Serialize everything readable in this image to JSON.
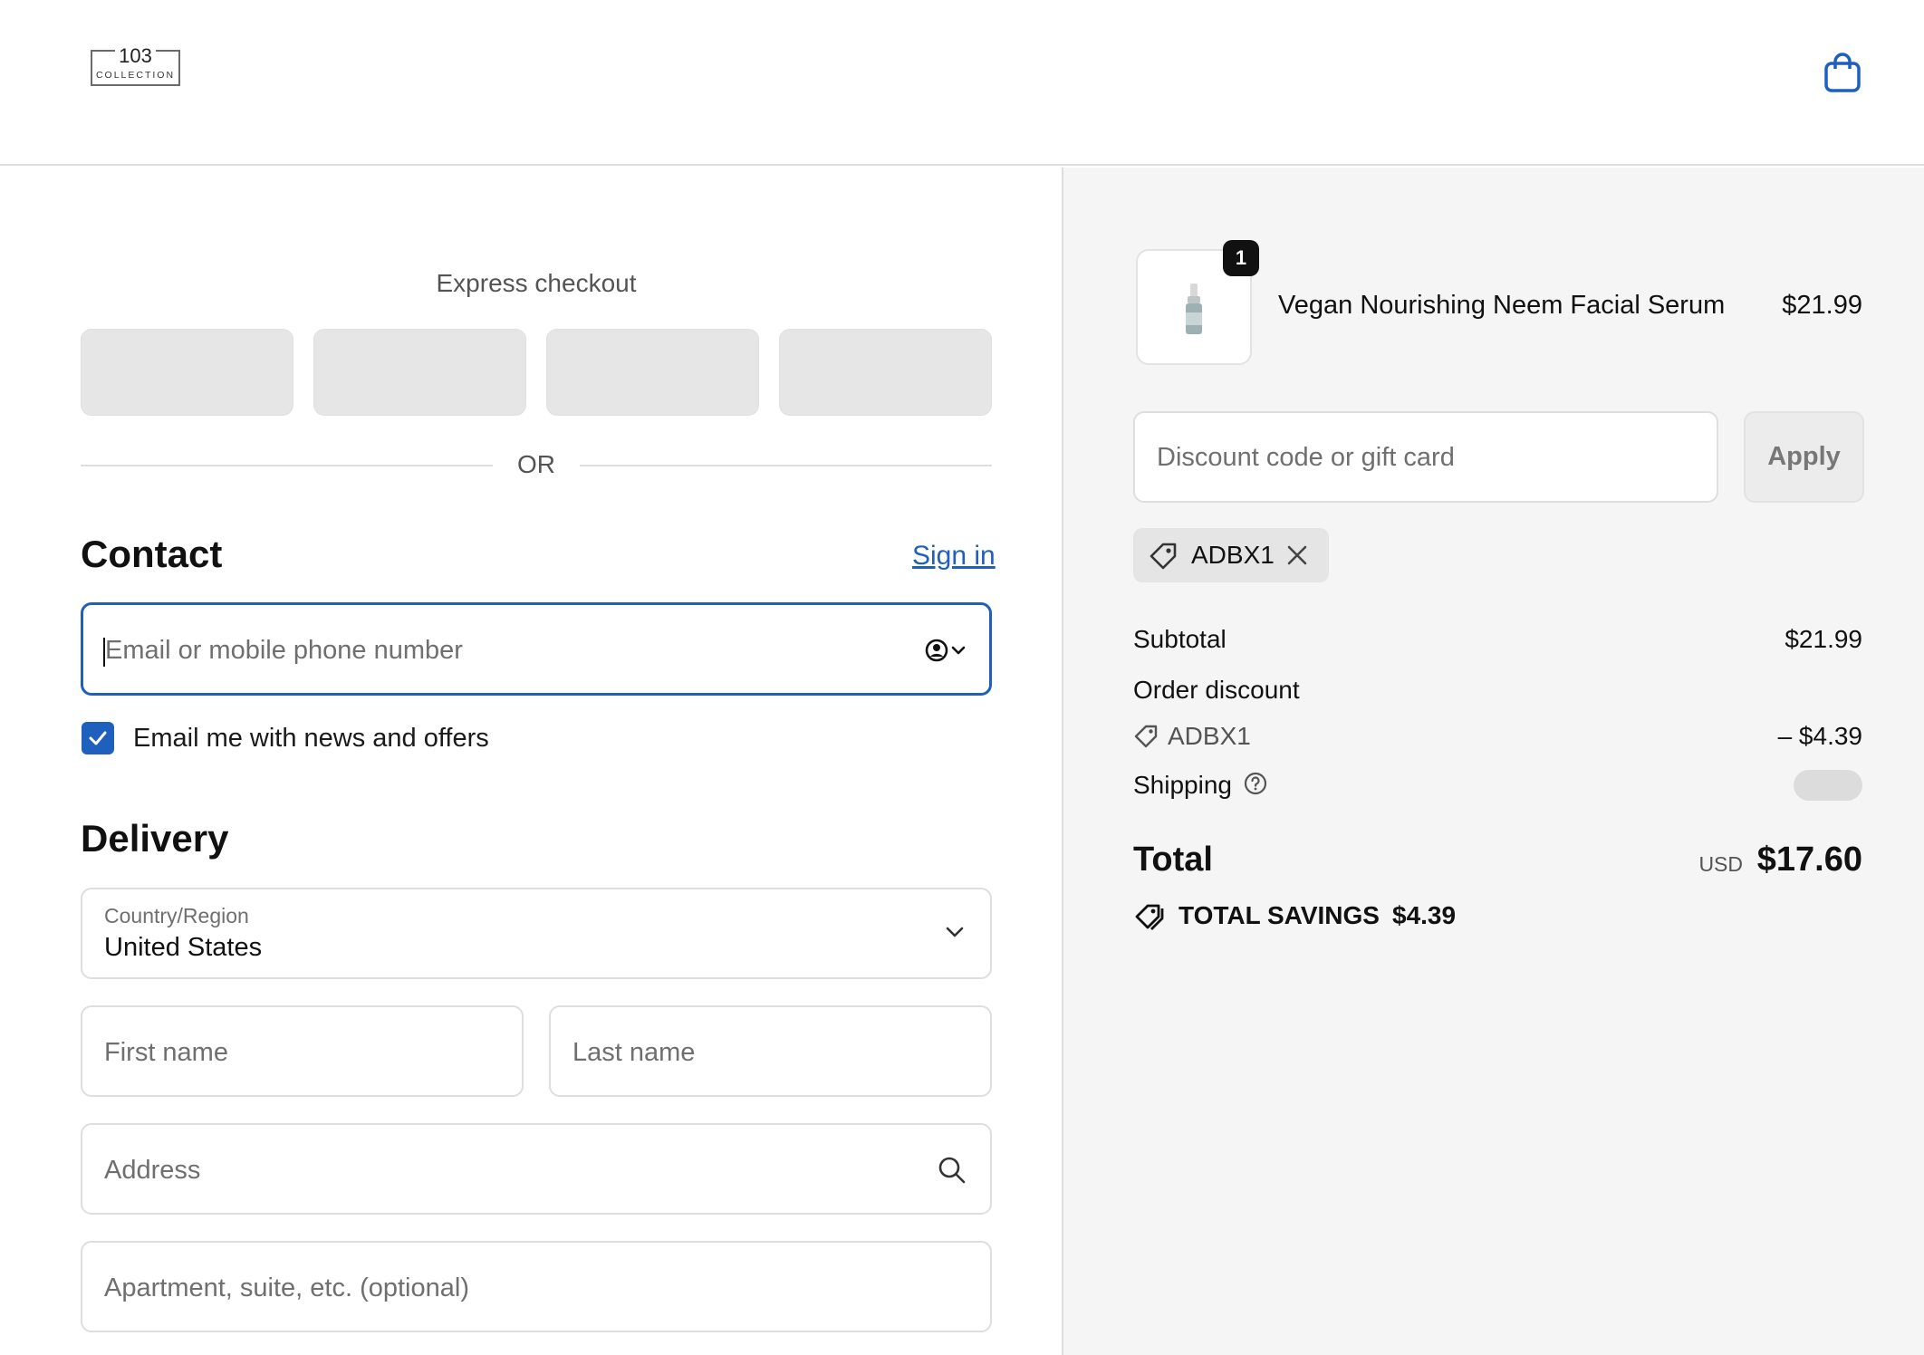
{
  "brand": {
    "logo_number": "103",
    "logo_word": "COLLECTION"
  },
  "checkout": {
    "express_title": "Express checkout",
    "or_text": "OR",
    "contact": {
      "heading": "Contact",
      "sign_in_label": "Sign in",
      "email_placeholder": "Email or mobile phone number",
      "news_checkbox_label": "Email me with news and offers",
      "news_checked": true
    },
    "delivery": {
      "heading": "Delivery",
      "country_label": "Country/Region",
      "country_value": "United States",
      "first_name_placeholder": "First name",
      "last_name_placeholder": "Last name",
      "address_placeholder": "Address",
      "apartment_placeholder": "Apartment, suite, etc. (optional)"
    }
  },
  "order_summary": {
    "item": {
      "name": "Vegan Nourishing Neem Facial Serum",
      "price": "$21.99",
      "quantity": "1"
    },
    "discount_placeholder": "Discount code or gift card",
    "apply_label": "Apply",
    "applied_code": "ADBX1",
    "subtotal_label": "Subtotal",
    "subtotal_value": "$21.99",
    "order_discount_label": "Order discount",
    "discount_code": "ADBX1",
    "discount_value": "– $4.39",
    "shipping_label": "Shipping",
    "total_label": "Total",
    "currency": "USD",
    "total_value": "$17.60",
    "savings_label": "TOTAL SAVINGS",
    "savings_value": "$4.39"
  },
  "colors": {
    "accent": "#1f5fbe",
    "summary_bg": "#f5f5f5"
  }
}
